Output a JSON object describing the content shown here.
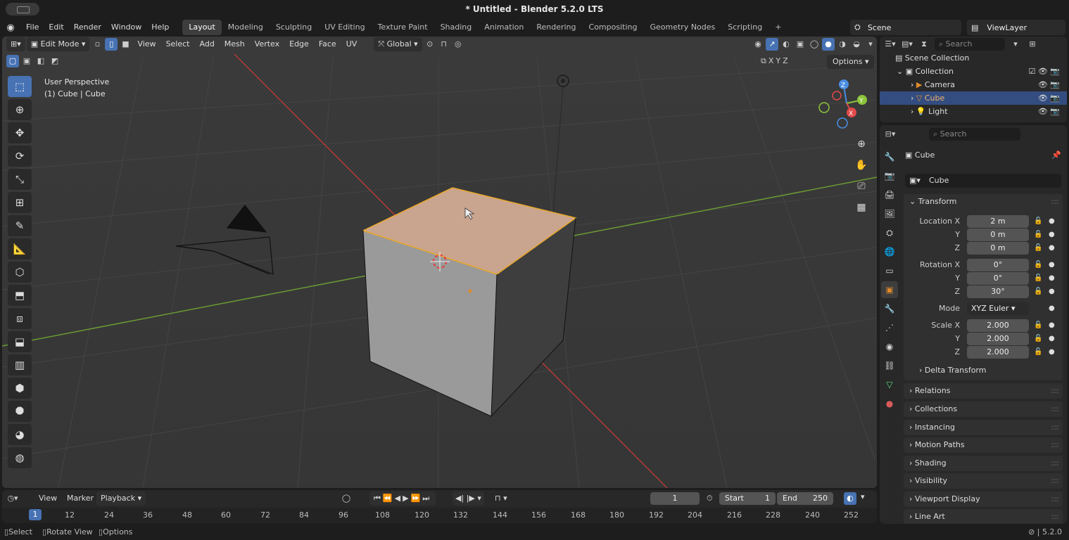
{
  "window": {
    "title": "* Untitled - Blender 5.2.0 LTS"
  },
  "menu": {
    "items": [
      "File",
      "Edit",
      "Render",
      "Window",
      "Help"
    ]
  },
  "workspaces": [
    "Layout",
    "Modeling",
    "Sculpting",
    "UV Editing",
    "Texture Paint",
    "Shading",
    "Animation",
    "Rendering",
    "Compositing",
    "Geometry Nodes",
    "Scripting",
    "+"
  ],
  "active_workspace": "Layout",
  "scene": {
    "name": "Scene",
    "view_layer": "ViewLayer"
  },
  "viewport": {
    "mode": "Edit Mode",
    "menus": [
      "View",
      "Select",
      "Add",
      "Mesh",
      "Vertex",
      "Edge",
      "Face",
      "UV"
    ],
    "orientation": "Global",
    "perspective": "User Perspective",
    "object_info": "(1) Cube | Cube",
    "options_label": "Options",
    "axes": {
      "x": "X",
      "y": "Y",
      "z": "Z"
    }
  },
  "outliner": {
    "search_placeholder": "Search",
    "root": "Scene Collection",
    "collection": "Collection",
    "items": [
      "Camera",
      "Cube",
      "Light"
    ]
  },
  "properties": {
    "search_placeholder": "Search",
    "object_name": "Cube",
    "datablock": "Cube",
    "transform_title": "Transform",
    "location_label": "Location X",
    "rotation_label": "Rotation X",
    "scale_label": "Scale X",
    "y_label": "Y",
    "z_label": "Z",
    "location": [
      "2 m",
      "0 m",
      "0 m"
    ],
    "rotation": [
      "0°",
      "0°",
      "30°"
    ],
    "mode_label": "Mode",
    "mode_value": "XYZ Euler",
    "scale": [
      "2.000",
      "2.000",
      "2.000"
    ],
    "delta": "Delta Transform",
    "panels": [
      "Relations",
      "Collections",
      "Instancing",
      "Motion Paths",
      "Shading",
      "Visibility",
      "Viewport Display",
      "Line Art"
    ]
  },
  "timeline": {
    "menus": [
      "View",
      "Marker",
      "Playback"
    ],
    "current_frame": "1",
    "start_label": "Start",
    "start": "1",
    "end_label": "End",
    "end": "250",
    "frame_ticks": [
      "1",
      "12",
      "24",
      "36",
      "48",
      "60",
      "72",
      "84",
      "96",
      "108",
      "120",
      "132",
      "144",
      "156",
      "168",
      "180",
      "192",
      "204",
      "216",
      "228",
      "240",
      "252"
    ]
  },
  "status": {
    "select": "Select",
    "rotate": "Rotate View",
    "options": "Options",
    "version": "5.2.0"
  },
  "colors": {
    "accent": "#4772b3",
    "selected_face": "#c9a48e",
    "x_axis": "#e24a4a",
    "y_axis": "#8cc43a",
    "z_axis": "#4a8ee2"
  }
}
